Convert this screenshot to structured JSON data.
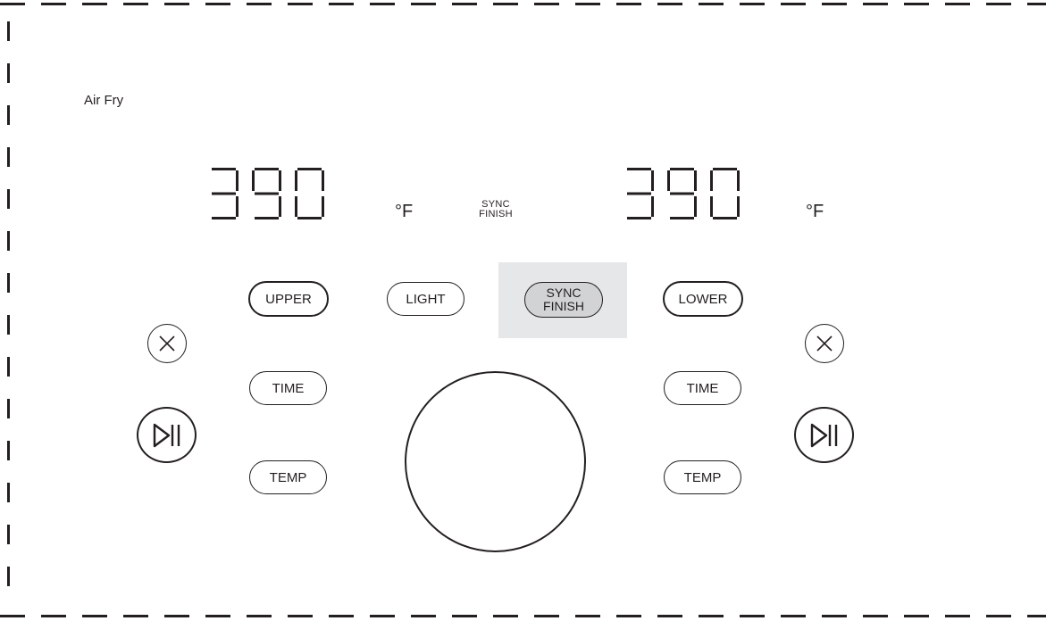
{
  "panel": {
    "mode": "Air Fry",
    "sync_indicator": {
      "line1": "SYNC",
      "line2": "FINISH"
    }
  },
  "upper": {
    "display": {
      "digits": "390",
      "unit": "°F"
    },
    "buttons": {
      "select": "UPPER",
      "time": "TIME",
      "temp": "TEMP"
    },
    "icons": {
      "cancel": "close-circle-icon",
      "start": "play-pause-icon"
    }
  },
  "lower": {
    "display": {
      "digits": "390",
      "unit": "°F"
    },
    "buttons": {
      "select": "LOWER",
      "time": "TIME",
      "temp": "TEMP"
    },
    "icons": {
      "cancel": "close-circle-icon",
      "start": "play-pause-icon"
    }
  },
  "center": {
    "light": "LIGHT",
    "sync_finish": {
      "line1": "SYNC",
      "line2": "FINISH",
      "highlighted": true
    },
    "knob": "dial-knob"
  },
  "colors": {
    "ink": "#231f20",
    "sync_shade": "#e6e7e8",
    "sync_button": "#d1d3d4",
    "background": "#ffffff"
  }
}
